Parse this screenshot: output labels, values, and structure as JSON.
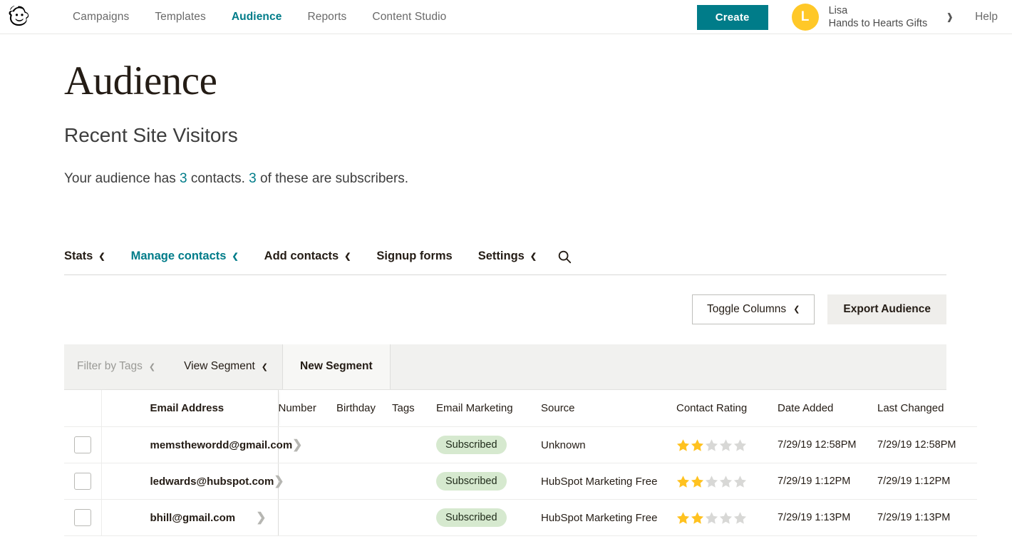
{
  "topnav": {
    "logo_icon": "mailchimp-freddie-logo",
    "links": [
      {
        "label": "Campaigns",
        "active": false
      },
      {
        "label": "Templates",
        "active": false
      },
      {
        "label": "Audience",
        "active": true
      },
      {
        "label": "Reports",
        "active": false
      },
      {
        "label": "Content Studio",
        "active": false
      }
    ],
    "create_label": "Create",
    "avatar_initial": "L",
    "account_name": "Lisa",
    "account_org": "Hands to Hearts Gifts",
    "account_caret": "chevron-down-icon",
    "help_label": "Help",
    "accent_color": "#007c89",
    "avatar_color": "#ffc828"
  },
  "page": {
    "title": "Audience",
    "audience_name": "Recent Site Visitors",
    "summary_prefix": "Your audience has ",
    "summary_contacts_count": "3",
    "summary_middle": " contacts. ",
    "summary_subscribers_count": "3",
    "summary_suffix": " of these are subscribers."
  },
  "tabs": [
    {
      "label": "Stats",
      "caret": true,
      "active": false
    },
    {
      "label": "Manage contacts",
      "caret": true,
      "active": true
    },
    {
      "label": "Add contacts",
      "caret": true,
      "active": false
    },
    {
      "label": "Signup forms",
      "caret": false,
      "active": false
    },
    {
      "label": "Settings",
      "caret": true,
      "active": false
    }
  ],
  "tabs_search_icon": "search-icon",
  "toolbar": {
    "toggle_columns_label": "Toggle Columns",
    "export_label": "Export Audience"
  },
  "segment_bar": {
    "filter_tags_label": "Filter by Tags",
    "view_segment_label": "View Segment",
    "new_segment_label": "New Segment"
  },
  "table": {
    "columns": [
      "Email Address",
      "Number",
      "Birthday",
      "Tags",
      "Email Marketing",
      "Source",
      "Contact Rating",
      "Date Added",
      "Last Changed"
    ],
    "rows": [
      {
        "email": "memsthewordd@gmail.com",
        "number": "",
        "birthday": "",
        "tags": "",
        "email_marketing": "Subscribed",
        "source": "Unknown",
        "rating": 2,
        "rating_max": 5,
        "date_added": "7/29/19 12:58PM",
        "last_changed": "7/29/19 12:58PM"
      },
      {
        "email": "ledwards@hubspot.com",
        "number": "",
        "birthday": "",
        "tags": "",
        "email_marketing": "Subscribed",
        "source": "HubSpot Marketing Free",
        "rating": 2,
        "rating_max": 5,
        "date_added": "7/29/19 1:12PM",
        "last_changed": "7/29/19 1:12PM"
      },
      {
        "email": "bhill@gmail.com",
        "number": "",
        "birthday": "",
        "tags": "",
        "email_marketing": "Subscribed",
        "source": "HubSpot Marketing Free",
        "rating": 2,
        "rating_max": 5,
        "date_added": "7/29/19 1:13PM",
        "last_changed": "7/29/19 1:13PM"
      }
    ],
    "pill_color": "#d6e9cf",
    "star_on_color": "#ffc220",
    "star_off_color": "#d8d8d6"
  }
}
